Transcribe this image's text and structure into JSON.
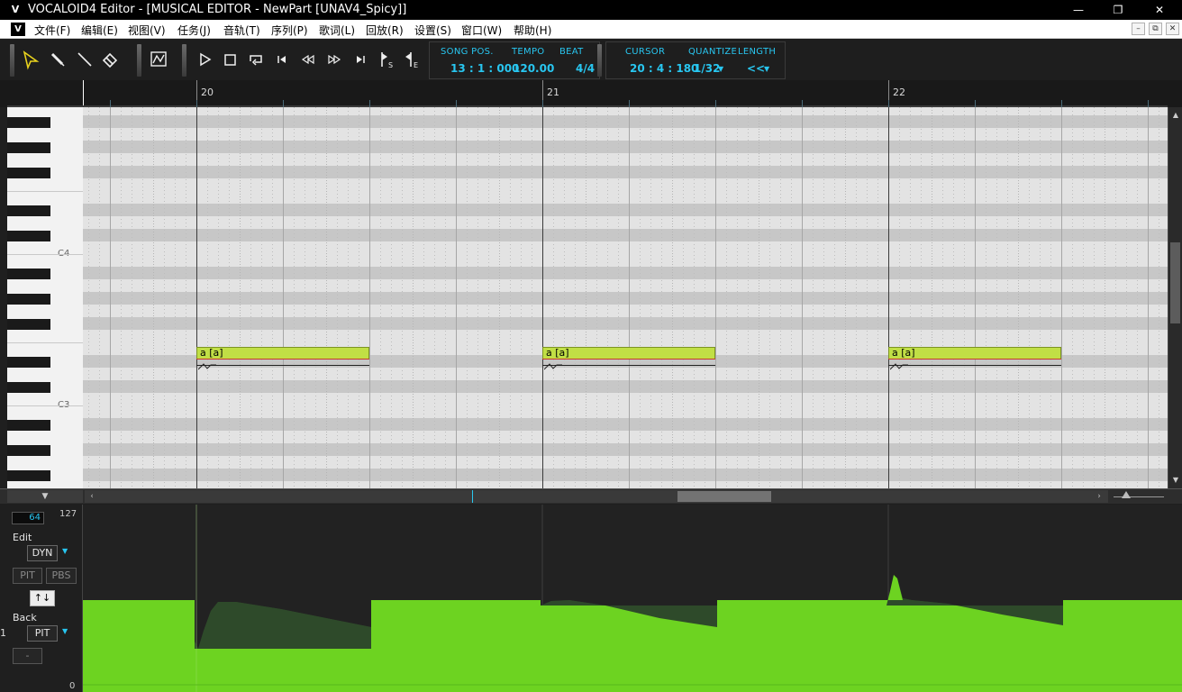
{
  "window": {
    "app_icon": "V",
    "title": "VOCALOID4 Editor - [MUSICAL EDITOR - NewPart [UNAV4_Spicy]]",
    "minimize": "—",
    "restore": "❐",
    "close": "✕"
  },
  "menubar": {
    "icon": "V",
    "items": [
      "文件(F)",
      "编辑(E)",
      "视图(V)",
      "任务(J)",
      "音轨(T)",
      "序列(P)",
      "歌词(L)",
      "回放(R)",
      "设置(S)",
      "窗口(W)",
      "帮助(H)"
    ],
    "mdi_buttons": [
      "–",
      "⧉",
      "✕"
    ]
  },
  "toolbar": {
    "tools": [
      "arrow-tool-icon",
      "pencil-tool-icon",
      "line-tool-icon",
      "eraser-tool-icon",
      "curve-editor-icon"
    ],
    "transport": [
      "play-icon",
      "stop-icon",
      "loop-icon",
      "goto-start-icon",
      "rewind-icon",
      "fast-forward-icon",
      "goto-end-icon",
      "start-marker-icon",
      "end-marker-icon"
    ],
    "song_pos_label": "SONG POS.",
    "song_pos_value": "13 : 1 : 000",
    "tempo_label": "TEMPO",
    "tempo_value": "120.00",
    "beat_label": "BEAT",
    "beat_value": "4/4",
    "cursor_label": "CURSOR",
    "cursor_value": "20 : 4 : 180",
    "quantize_label": "QUANTIZE",
    "quantize_value": "1/32",
    "length_label": "LENGTH",
    "length_value": "<<",
    "accent_color": "#28c6f0"
  },
  "ruler": {
    "bars": [
      "20",
      "21",
      "22"
    ]
  },
  "keyboard": {
    "labels": [
      "C4",
      "C3"
    ]
  },
  "notes": [
    {
      "lyric": "a [a]",
      "bar": 20,
      "beat": 1,
      "length_beats": 2
    },
    {
      "lyric": "a [a]",
      "bar": 21,
      "beat": 1,
      "length_beats": 2
    },
    {
      "lyric": "a [a]",
      "bar": 22,
      "beat": 1,
      "length_beats": 2
    }
  ],
  "note_color": "#c1df45",
  "control": {
    "value": "64",
    "max": "127",
    "min": "0",
    "edit_label": "Edit",
    "edit_param": "DYN",
    "pit_button": "PIT",
    "pbs_button": "PBS",
    "swap_button": "↑↓",
    "back_label": "Back",
    "back_param": "PIT",
    "minus_button": "-",
    "side_number": "1",
    "curve_color": "#6dd321"
  }
}
